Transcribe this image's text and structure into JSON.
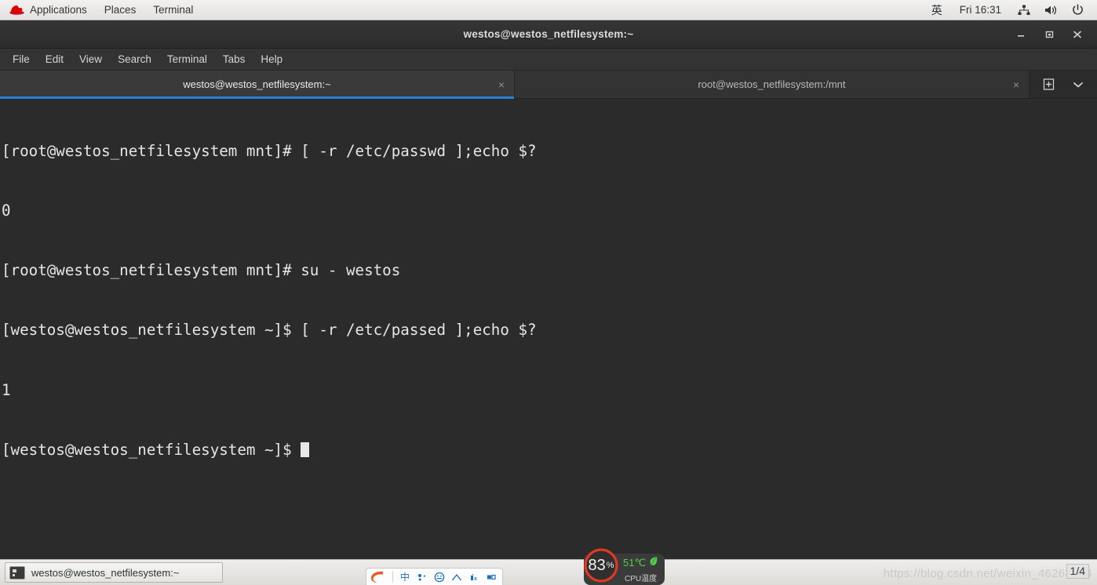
{
  "theme": {
    "accent": "#2d7fd3",
    "terminal_bg": "#2b2b2b",
    "terminal_fg": "#e6e6e6",
    "panel_bg": "#ededeb",
    "cpu_ring": "#e03a24",
    "cpu_temp_color": "#4fd14f",
    "ime_logo": "#f05a28"
  },
  "top_panel": {
    "logo_icon": "redhat-logo-icon",
    "menus": [
      {
        "label": "Applications"
      },
      {
        "label": "Places"
      },
      {
        "label": "Terminal"
      }
    ],
    "input_method": "英",
    "clock": "Fri 16:31",
    "icons": [
      {
        "name": "network-icon"
      },
      {
        "name": "volume-icon"
      },
      {
        "name": "power-icon"
      }
    ]
  },
  "window": {
    "title": "westos@westos_netfilesystem:~",
    "controls": {
      "minimize": "minimize-icon",
      "maximize": "maximize-icon",
      "close": "close-icon"
    },
    "menubar": [
      {
        "label": "File"
      },
      {
        "label": "Edit"
      },
      {
        "label": "View"
      },
      {
        "label": "Search"
      },
      {
        "label": "Terminal"
      },
      {
        "label": "Tabs"
      },
      {
        "label": "Help"
      }
    ],
    "tabs": [
      {
        "label": "westos@westos_netfilesystem:~",
        "active": true,
        "close": "×"
      },
      {
        "label": "root@westos_netfilesystem:/mnt",
        "active": false,
        "close": "×"
      }
    ],
    "tab_actions": {
      "new_tab": "new-tab-icon",
      "tab_list": "chevron-down-icon"
    }
  },
  "terminal": {
    "lines": [
      "[root@westos_netfilesystem mnt]# [ -r /etc/passwd ];echo $?",
      "0",
      "[root@westos_netfilesystem mnt]# su - westos",
      "[westos@westos_netfilesystem ~]$ [ -r /etc/passed ];echo $?",
      "1"
    ],
    "prompt": "[westos@westos_netfilesystem ~]$ ",
    "cursor": "block"
  },
  "taskbar": {
    "items": [
      {
        "label": "westos@westos_netfilesystem:~",
        "icon": "terminal-icon"
      }
    ]
  },
  "ime_toolbar": {
    "logo": "sogou-logo-icon",
    "buttons": [
      {
        "name": "chinese-mode-icon",
        "glyph": "中"
      },
      {
        "name": "punctuation-icon",
        "glyph": "，"
      },
      {
        "name": "emoji-icon",
        "glyph": "☺"
      },
      {
        "name": "toolbox-icon",
        "glyph": "⌂"
      },
      {
        "name": "skin-icon",
        "glyph": "▯"
      },
      {
        "name": "menu-icon",
        "glyph": "▣"
      }
    ]
  },
  "cpu_widget": {
    "usage": "83",
    "usage_unit": "%",
    "temperature": "51℃",
    "temp_icon": "leaf-icon",
    "label": "CPU温度"
  },
  "watermark": {
    "url": "https://blog.csdn.net/weixin_46268244",
    "page_indicator": "1/4"
  }
}
